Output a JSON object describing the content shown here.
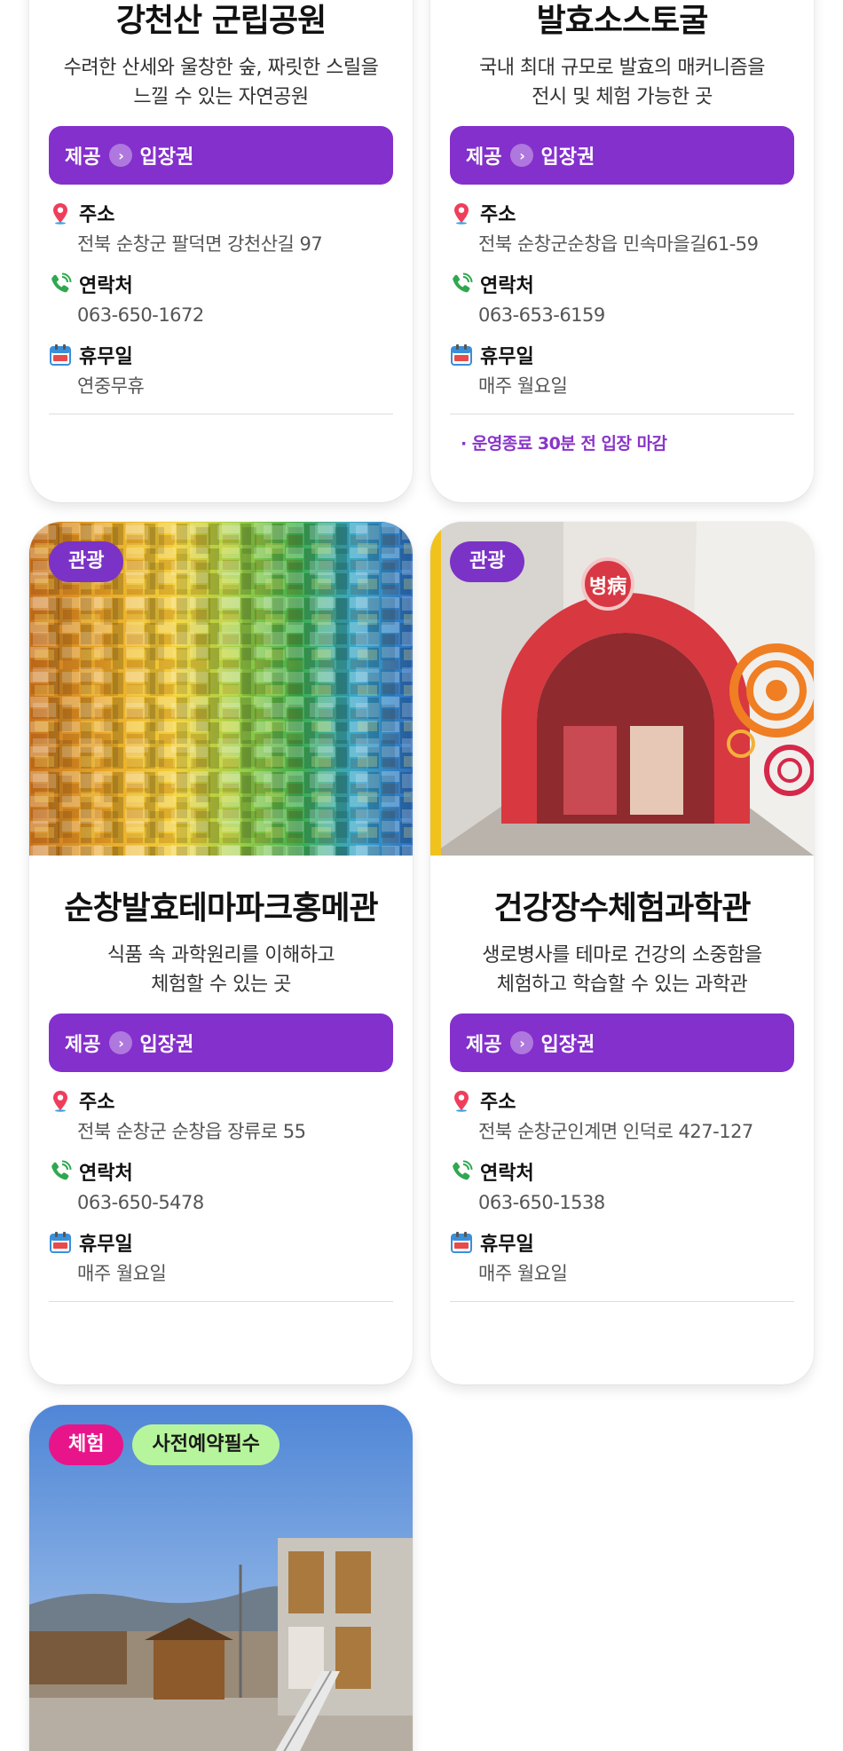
{
  "labels": {
    "provide": "제공",
    "ticket": "입장권",
    "address": "주소",
    "contact": "연락처",
    "holiday": "휴무일"
  },
  "cards": [
    {
      "title": "강천산 군립공원",
      "desc_lines": [
        "수려한 산세와 울창한 숲, 짜릿한 스릴을",
        "느낄 수 있는 자연공원"
      ],
      "address": "전북 순창군 팔덕면 강천산길 97",
      "phone": "063-650-1672",
      "holiday": "연중무휴",
      "note": ""
    },
    {
      "title": "발효소스토굴",
      "desc_lines": [
        "국내 최대 규모로 발효의 매커니즘을",
        "전시 및 체험 가능한 곳"
      ],
      "address": "전북 순창군순창읍 민속마을길61-59",
      "phone": "063-653-6159",
      "holiday": "매주 월요일",
      "note": "· 운영종료 30분 전 입장 마감"
    },
    {
      "badges": [
        "관광"
      ],
      "title": "순창발효테마파크홍메관",
      "desc_lines": [
        "식품 속 과학원리를 이해하고",
        "체험할 수 있는 곳"
      ],
      "address": "전북 순창군 순창읍 장류로 55",
      "phone": "063-650-5478",
      "holiday": "매주 월요일",
      "note": ""
    },
    {
      "badges": [
        "관광"
      ],
      "title": "건강장수체험과학관",
      "desc_lines": [
        "생로병사를 테마로 건강의 소중함을",
        "체험하고 학습할 수 있는 과학관"
      ],
      "address": "전북 순창군인계면 인덕로 427-127",
      "phone": "063-650-1538",
      "holiday": "매주 월요일",
      "note": ""
    },
    {
      "badges": [
        "체험",
        "사전예약필수"
      ]
    }
  ],
  "image_text": {
    "hall_sign": "병病"
  },
  "colors": {
    "provide_bar": "#8430cc",
    "badge_purple": "#7b32c6",
    "badge_pink": "#e8158a",
    "badge_green": "#b6f59c",
    "note": "#8a35c9"
  },
  "icons": {
    "address": "map-pin-icon",
    "contact": "phone-icon",
    "holiday": "calendar-icon",
    "provide": "chevron-right-icon"
  }
}
